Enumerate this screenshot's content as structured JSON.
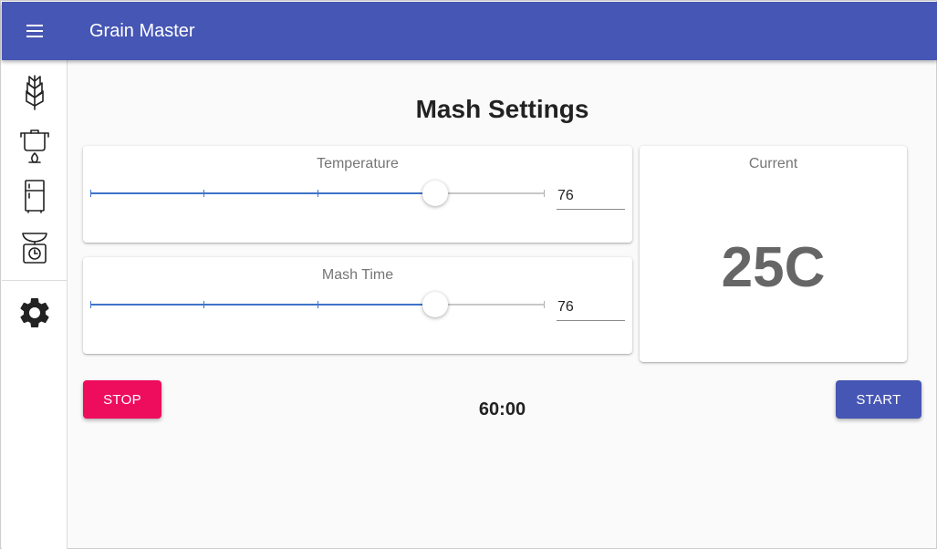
{
  "app": {
    "title": "Grain Master",
    "accent_color": "#4656b4"
  },
  "sidebar": {
    "items": [
      {
        "icon": "wheat-icon"
      },
      {
        "icon": "mash-pot-icon"
      },
      {
        "icon": "fridge-icon"
      },
      {
        "icon": "scale-timer-icon"
      },
      {
        "icon": "gear-icon"
      }
    ]
  },
  "main": {
    "title": "Mash Settings",
    "temperature": {
      "label": "Temperature",
      "value": "76",
      "slider_fraction": 0.76,
      "ticks": [
        0,
        0.25,
        0.5,
        1
      ]
    },
    "mash_time": {
      "label": "Mash Time",
      "value": "76",
      "slider_fraction": 0.76,
      "ticks": [
        0,
        0.25,
        0.5,
        1
      ]
    },
    "current": {
      "label": "Current",
      "value": "25C"
    },
    "timer": "60:00",
    "stop_label": "STOP",
    "start_label": "START",
    "stop_color": "#ee0d5d",
    "start_color": "#4656b4"
  }
}
